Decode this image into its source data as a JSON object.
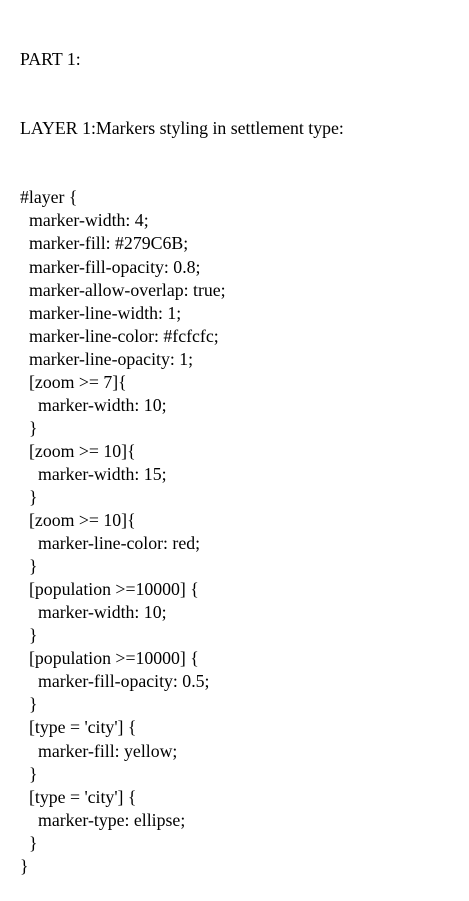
{
  "document": {
    "heading": "PART 1:",
    "subheading": "LAYER 1:Markers styling in settlement type:",
    "lines": [
      {
        "indent": 0,
        "text": "#layer {"
      },
      {
        "indent": 1,
        "text": "marker-width: 4;"
      },
      {
        "indent": 1,
        "text": "marker-fill: #279C6B;"
      },
      {
        "indent": 1,
        "text": "marker-fill-opacity: 0.8;"
      },
      {
        "indent": 1,
        "text": "marker-allow-overlap: true;"
      },
      {
        "indent": 1,
        "text": "marker-line-width: 1;"
      },
      {
        "indent": 1,
        "text": "marker-line-color: #fcfcfc;"
      },
      {
        "indent": 1,
        "text": "marker-line-opacity: 1;"
      },
      {
        "indent": 1,
        "text": "[zoom >= 7]{"
      },
      {
        "indent": 2,
        "text": "marker-width: 10;"
      },
      {
        "indent": 1,
        "text": "}"
      },
      {
        "indent": 1,
        "text": "[zoom >= 10]{"
      },
      {
        "indent": 2,
        "text": "marker-width: 15;"
      },
      {
        "indent": 1,
        "text": "}"
      },
      {
        "indent": 1,
        "text": "[zoom >= 10]{"
      },
      {
        "indent": 2,
        "text": "marker-line-color: red;"
      },
      {
        "indent": 1,
        "text": "}"
      },
      {
        "indent": 1,
        "text": "[population >=10000] {"
      },
      {
        "indent": 2,
        "text": "marker-width: 10;"
      },
      {
        "indent": 1,
        "text": "}"
      },
      {
        "indent": 1,
        "text": "[population >=10000] {"
      },
      {
        "indent": 2,
        "text": "marker-fill-opacity: 0.5;"
      },
      {
        "indent": 1,
        "text": "}"
      },
      {
        "indent": 1,
        "text": "[type = 'city'] {"
      },
      {
        "indent": 2,
        "text": "marker-fill: yellow;"
      },
      {
        "indent": 1,
        "text": "}"
      },
      {
        "indent": 1,
        "text": "[type = 'city'] {"
      },
      {
        "indent": 2,
        "text": "marker-type: ellipse;"
      },
      {
        "indent": 1,
        "text": "}"
      },
      {
        "indent": 0,
        "text": "}"
      }
    ]
  }
}
